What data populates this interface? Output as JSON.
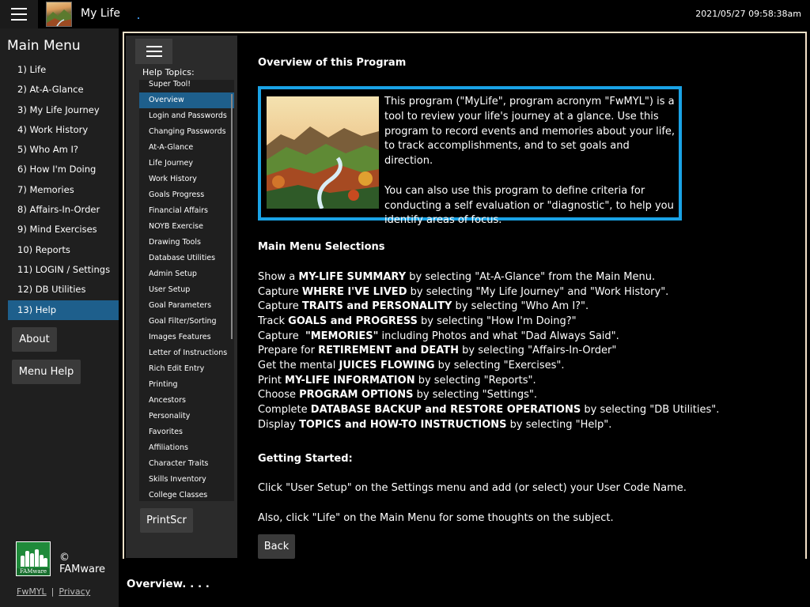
{
  "titlebar": {
    "app_title": "My Life",
    "clock": "2021/05/27  09:58:38am"
  },
  "mainmenu": {
    "title": "Main Menu",
    "items": [
      {
        "label": "1) Life"
      },
      {
        "label": "2) At-A-Glance"
      },
      {
        "label": "3) My Life Journey"
      },
      {
        "label": "4) Work History"
      },
      {
        "label": "5) Who Am I?"
      },
      {
        "label": "6) How I'm Doing"
      },
      {
        "label": "7) Memories"
      },
      {
        "label": "8) Affairs-In-Order"
      },
      {
        "label": "9) Mind Exercises"
      },
      {
        "label": "10) Reports"
      },
      {
        "label": "11) LOGIN / Settings"
      },
      {
        "label": "12) DB Utilities"
      },
      {
        "label": "13) Help",
        "active": true
      }
    ],
    "about_label": "About",
    "menu_help_label": "Menu Help",
    "logo_text": "FAMware",
    "copyright": "© FAMware",
    "link_fwmyl": "FwMYL",
    "link_privacy": "Privacy"
  },
  "help": {
    "topics_label": "Help Topics:",
    "topics": [
      {
        "label": "Super Tool!"
      },
      {
        "label": "Overview",
        "active": true
      },
      {
        "label": "Login and Passwords"
      },
      {
        "label": "Changing Passwords"
      },
      {
        "label": "At-A-Glance"
      },
      {
        "label": "Life Journey"
      },
      {
        "label": "Work History"
      },
      {
        "label": "Goals Progress"
      },
      {
        "label": "Financial Affairs"
      },
      {
        "label": "NOYB Exercise"
      },
      {
        "label": "Drawing Tools"
      },
      {
        "label": "Database Utilities"
      },
      {
        "label": "Admin Setup"
      },
      {
        "label": "User Setup"
      },
      {
        "label": "Goal Parameters"
      },
      {
        "label": "Goal Filter/Sorting"
      },
      {
        "label": "Images Features"
      },
      {
        "label": "Letter of Instructions"
      },
      {
        "label": "Rich Edit Entry"
      },
      {
        "label": "Printing"
      },
      {
        "label": "Ancestors"
      },
      {
        "label": "Personality"
      },
      {
        "label": "Favorites"
      },
      {
        "label": "Affiliations"
      },
      {
        "label": "Character Traits"
      },
      {
        "label": "Skills Inventory"
      },
      {
        "label": "College Classes"
      }
    ],
    "printscr_label": "PrintScr"
  },
  "content": {
    "overview_title": "Overview of this Program",
    "intro_p1": "This program (\"MyLife\", program acronym \"FwMYL\") is a tool to review your life's journey at a glance. Use this program to record events and memories about your life, to track accomplishments, and to set goals and direction.",
    "intro_p2": "You can also use this program to define criteria for conducting a self evaluation or \"diagnostic\", to help you identify areas of focus.",
    "main_menu_title": "Main Menu Selections",
    "selections": [
      {
        "pre": "Show a ",
        "bold": "MY-LIFE SUMMARY",
        "post": " by selecting \"At-A-Glance\" from the Main Menu."
      },
      {
        "pre": "Capture ",
        "bold": "WHERE I'VE LIVED",
        "post": " by selecting \"My Life Journey\" and \"Work History\"."
      },
      {
        "pre": "Capture ",
        "bold": "TRAITS and PERSONALITY",
        "post": " by selecting \"Who Am I?\"."
      },
      {
        "pre": "Track ",
        "bold": "GOALS and PROGRESS",
        "post": " by selecting \"How I'm Doing?\""
      },
      {
        "pre": "Capture  ",
        "bold": "\"MEMORIES\"",
        "post": " including Photos and what \"Dad Always Said\"."
      },
      {
        "pre": "Prepare for ",
        "bold": "RETIREMENT and DEATH",
        "post": " by selecting \"Affairs-In-Order\""
      },
      {
        "pre": "Get the mental ",
        "bold": "JUICES FLOWING",
        "post": " by selecting \"Exercises\"."
      },
      {
        "pre": "Print ",
        "bold": "MY-LIFE INFORMATION",
        "post": " by selecting \"Reports\"."
      },
      {
        "pre": "Choose ",
        "bold": "PROGRAM OPTIONS",
        "post": " by selecting \"Settings\"."
      },
      {
        "pre": "Complete ",
        "bold": "DATABASE BACKUP and RESTORE OPERATIONS",
        "post": " by selecting \"DB Utilities\"."
      },
      {
        "pre": "Display ",
        "bold": "TOPICS and HOW-TO INSTRUCTIONS",
        "post": " by selecting \"Help\"."
      }
    ],
    "getting_started_title": "Getting Started:",
    "gs_line1": "Click \"User Setup\" on the Settings menu and add (or select) your User Code Name.",
    "gs_line2": "Also, click \"Life\" on the Main Menu for some thoughts on the subject.",
    "back_label": "Back"
  },
  "status": {
    "text": "Overview. . . ."
  },
  "colors": {
    "accent_blue": "#1aa3e6",
    "active_blue": "#1e5f8c",
    "frame_border": "#f3e1c8",
    "logo_green": "#1f8a3a"
  }
}
